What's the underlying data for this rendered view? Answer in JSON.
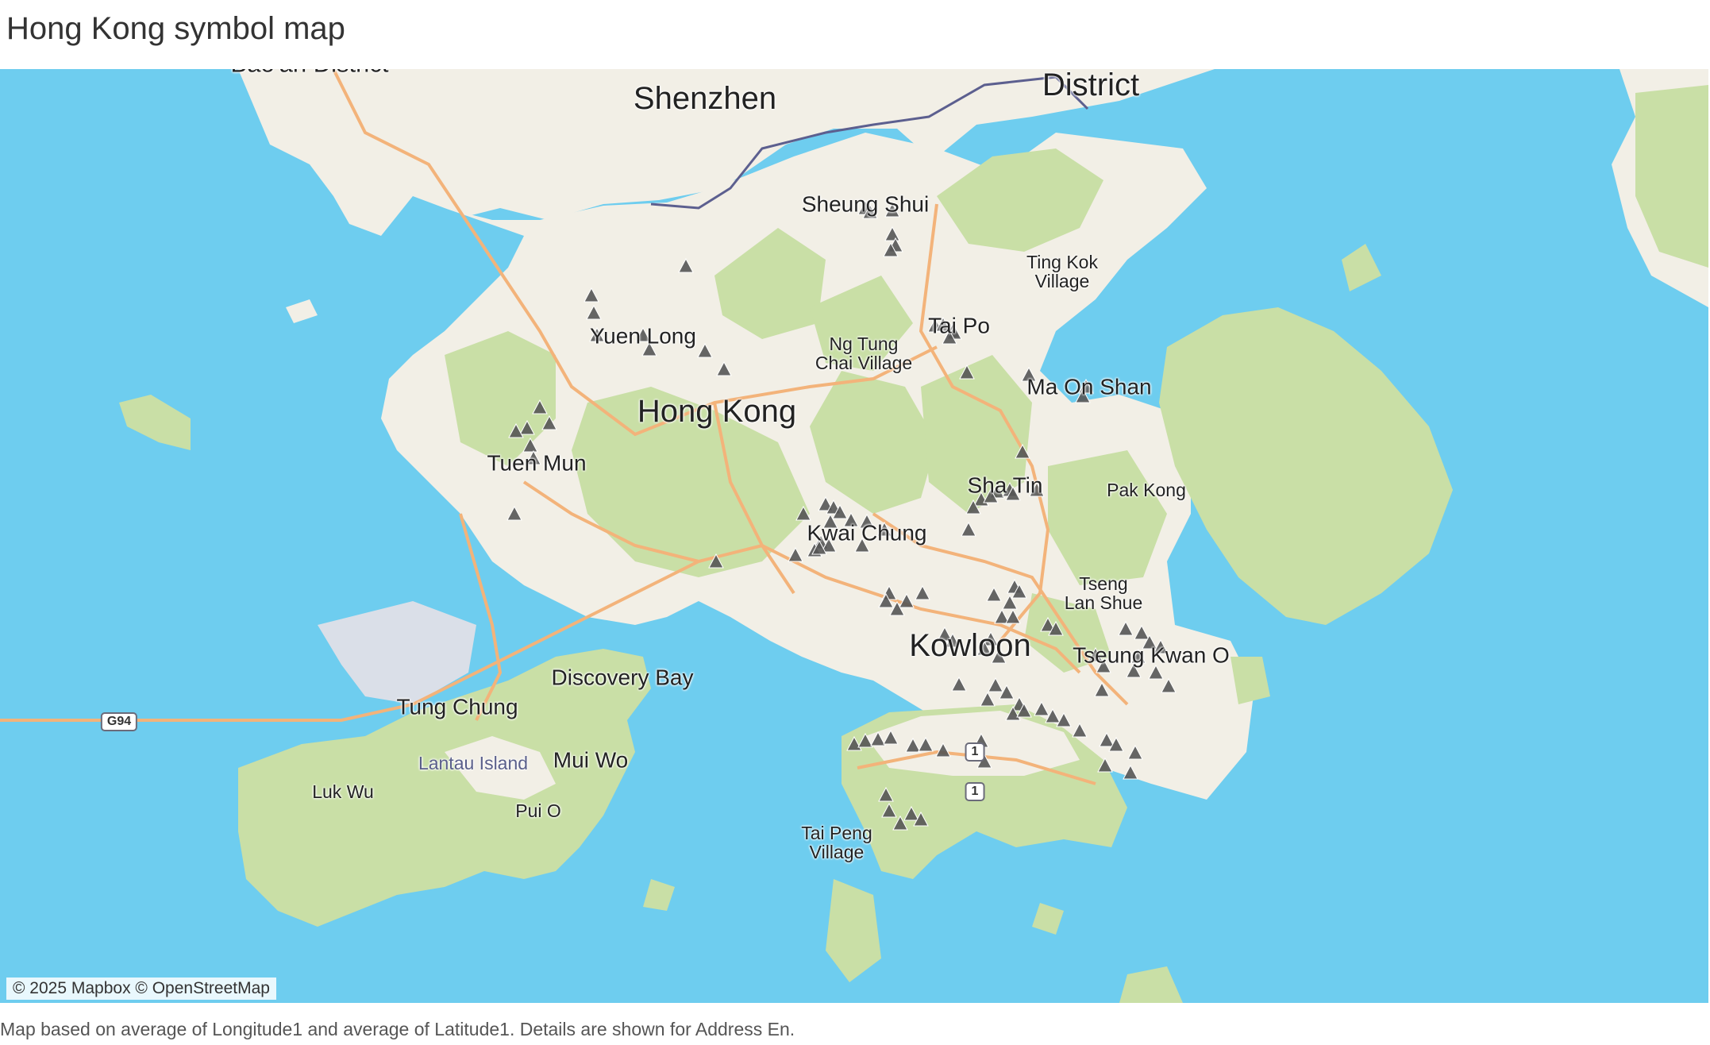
{
  "title": "Hong Kong symbol map",
  "caption": "Map based on average of Longitude1 and average of Latitude1.  Details are shown for Address En.",
  "attribution": "© 2025 Mapbox © OpenStreetMap",
  "colors": {
    "water": "#6ecdef",
    "land": "#f2efe6",
    "vegetation": "#c9dfa6",
    "road": "#f3b37a",
    "marker": "#555555",
    "border": "#5c5f8f"
  },
  "places": {
    "baoan": "Bao'an District",
    "shenzhen": "Shenzhen",
    "district": "District",
    "sheung_shui": "Sheung Shui",
    "ting_kok": "Ting Kok\nVillage",
    "tai_po": "Tai Po",
    "yuen_long": "Yuen Long",
    "ng_tung": "Ng Tung\nChai Village",
    "hong_kong": "Hong Kong",
    "ma_on_shan": "Ma On Shan",
    "tuen_mun": "Tuen Mun",
    "sha_tin": "Sha Tin",
    "pak_kong": "Pak Kong",
    "kwai_chung": "Kwai Chung",
    "tseng_lan_shue": "Tseng\nLan Shue",
    "kowloon": "Kowloon",
    "tseung_kwan_o": "Tseung Kwan O",
    "discovery_bay": "Discovery Bay",
    "tung_chung": "Tung Chung",
    "lantau_island": "Lantau Island",
    "mui_wo": "Mui Wo",
    "luk_wu": "Luk Wu",
    "pui_o": "Pui O",
    "tai_peng": "Tai Peng\nVillage"
  },
  "road_shields": {
    "g94": "G94",
    "route1a": "1",
    "route1b": "1"
  },
  "symbol": {
    "shape": "triangle",
    "color": "#555555",
    "count": 96
  }
}
